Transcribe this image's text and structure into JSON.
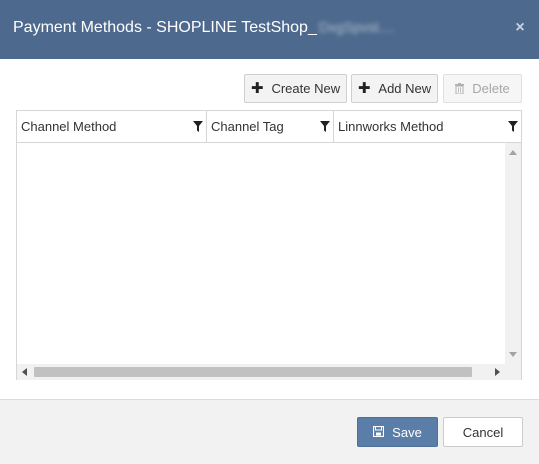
{
  "dialog": {
    "title": "Payment Methods - SHOPLINE TestShop_",
    "title_obscured": "DxgSpvst....",
    "close_glyph": "×"
  },
  "toolbar": {
    "create_new_label": "Create New",
    "add_new_label": "Add New",
    "delete_label": "Delete",
    "delete_enabled": false
  },
  "grid": {
    "columns": [
      {
        "label": "Channel Method"
      },
      {
        "label": "Channel Tag"
      },
      {
        "label": "Linnworks Method"
      }
    ],
    "rows": []
  },
  "footer": {
    "save_label": "Save",
    "cancel_label": "Cancel"
  },
  "colors": {
    "header_bg": "#4d6a8e",
    "primary_button": "#5b7ea8"
  }
}
